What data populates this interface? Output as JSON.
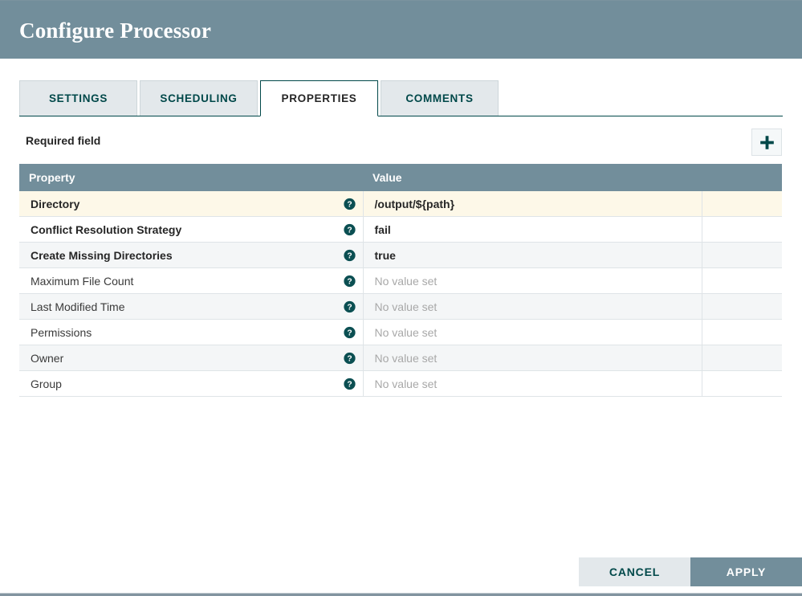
{
  "header": {
    "title": "Configure Processor"
  },
  "tabs": [
    {
      "label": "SETTINGS",
      "active": false
    },
    {
      "label": "SCHEDULING",
      "active": false
    },
    {
      "label": "PROPERTIES",
      "active": true
    },
    {
      "label": "COMMENTS",
      "active": false
    }
  ],
  "toolbar": {
    "required_field_label": "Required field",
    "add_property_icon": "plus-icon"
  },
  "table": {
    "columns": [
      "Property",
      "Value",
      ""
    ],
    "help_icon": "help-circle-icon",
    "no_value_placeholder": "No value set",
    "rows": [
      {
        "property": "Directory",
        "value": "/output/${path}",
        "required": true,
        "has_value": true,
        "highlight": true
      },
      {
        "property": "Conflict Resolution Strategy",
        "value": "fail",
        "required": true,
        "has_value": true,
        "highlight": false
      },
      {
        "property": "Create Missing Directories",
        "value": "true",
        "required": true,
        "has_value": true,
        "highlight": false
      },
      {
        "property": "Maximum File Count",
        "value": "No value set",
        "required": false,
        "has_value": false,
        "highlight": false
      },
      {
        "property": "Last Modified Time",
        "value": "No value set",
        "required": false,
        "has_value": false,
        "highlight": false
      },
      {
        "property": "Permissions",
        "value": "No value set",
        "required": false,
        "has_value": false,
        "highlight": false
      },
      {
        "property": "Owner",
        "value": "No value set",
        "required": false,
        "has_value": false,
        "highlight": false
      },
      {
        "property": "Group",
        "value": "No value set",
        "required": false,
        "has_value": false,
        "highlight": false
      }
    ]
  },
  "footer": {
    "cancel_label": "CANCEL",
    "apply_label": "APPLY"
  },
  "colors": {
    "header_bar": "#728e9b",
    "accent_teal": "#004849",
    "required_row": "#fdf8e8",
    "row_alt": "#f4f6f7",
    "apply_button": "#728e9b",
    "cancel_button": "#e3e8eb"
  }
}
